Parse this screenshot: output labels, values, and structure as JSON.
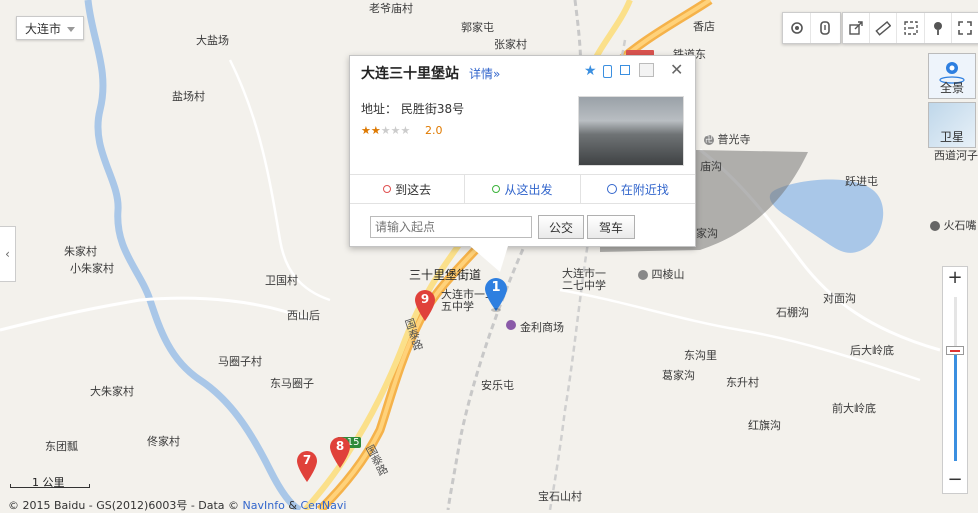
{
  "city_selector": {
    "label": "大连市"
  },
  "toolbar_left": [
    "traffic-icon",
    "subway-icon"
  ],
  "toolbar_right": [
    "share-icon",
    "ruler-icon",
    "zoom-box-icon",
    "marker-tool-icon",
    "fullscreen-icon"
  ],
  "layers": {
    "panorama": "全景",
    "satellite": "卫星"
  },
  "popup": {
    "title": "大连三十里堡站",
    "detail_link": "详情»",
    "address": "地址： 民胜街38号",
    "stars": "★★★★★",
    "rating": "2.0",
    "rating_value": 2,
    "tabs": [
      {
        "label": "到这去",
        "icon_color": "#e05050"
      },
      {
        "label": "从这出发",
        "icon_color": "#3bb33b"
      },
      {
        "label": "在附近找",
        "icon_color": "#3366cc"
      }
    ],
    "origin_placeholder": "请输入起点",
    "bus_button": "公交",
    "drive_button": "驾车"
  },
  "markers": [
    {
      "label": "1",
      "color": "#2e7fe0"
    },
    {
      "label": "9",
      "color": "#e0413a"
    },
    {
      "label": "8",
      "color": "#e0413a"
    },
    {
      "label": "7",
      "color": "#e0413a"
    }
  ],
  "road_badge": "G15",
  "places": {
    "dayanchang": "大盐场",
    "yanchangcun": "盐场村",
    "zhujiacun": "朱家村",
    "xiaozhujiacun": "小朱家村",
    "weiguocun": "卫国村",
    "xishanhou": "西山后",
    "majuanzicun": "马圈子村",
    "dongmajuanzi": "东马圈子",
    "dazhujiacun": "大朱家村",
    "dongtuanpiao": "东团瓢",
    "jiajiacun": "佟家村",
    "guojiatun": "郭家屯",
    "zhangjiacun": "张家村",
    "puguangsi": "普光寺",
    "miaogou": "庙沟",
    "yuejintun": "跃进屯",
    "xidaohezi": "西道河子",
    "huoshizui": "火石嘴",
    "sishilijiedao": "三十里堡街道",
    "dalianshi125": "大连市一二五中学",
    "dalianshi127": "大连市一二七中学",
    "silingshan": "四棱山",
    "jinlishangchang": "金利商场",
    "anletun": "安乐屯",
    "duimiangou": "对面沟",
    "shipenggou": "石棚沟",
    "houdalingdi": "后大岭底",
    "donggoulie": "东沟里",
    "gejiagou": "葛家沟",
    "dongshengcun": "东升村",
    "qiandalingdi": "前大岭底",
    "hongqigou": "红旗沟",
    "baoshishancun": "宝石山村",
    "guotai_road": "国泰路",
    "guotai_road2": "国泰路",
    "xiangpu": "香店",
    "zhudaodong": "铁道东",
    "laozhaohou": "老爷庙村",
    "jiaogou": "家沟"
  },
  "scale": "1 公里",
  "copyright": {
    "text": "© 2015 Baidu - GS(2012)6003号 - Data © ",
    "link1": "NavInfo",
    "amp": " & ",
    "link2": "CenNavi"
  },
  "zoom": {
    "in": "+",
    "out": "−"
  },
  "side_tab": "‹"
}
